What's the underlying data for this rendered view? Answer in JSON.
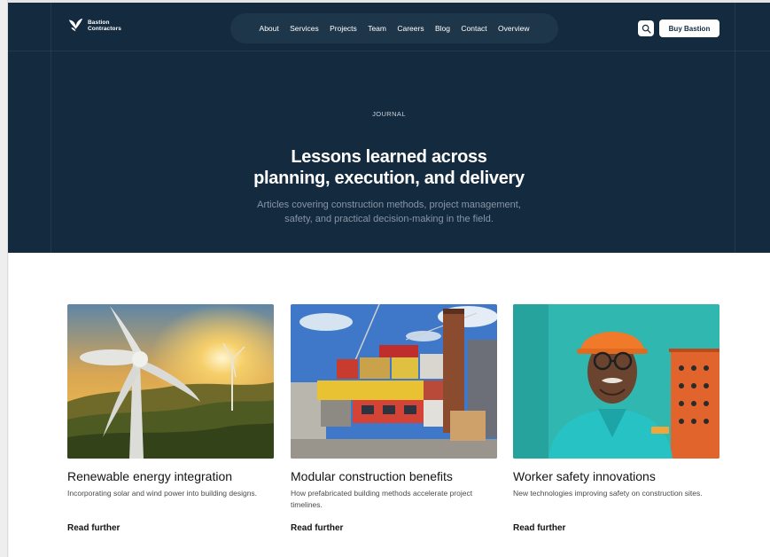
{
  "brand": {
    "line1": "Bastion",
    "line2": "Contractors"
  },
  "nav": {
    "items": [
      "About",
      "Services",
      "Projects",
      "Team",
      "Careers",
      "Blog",
      "Contact",
      "Overview"
    ]
  },
  "header": {
    "buy_label": "Buy Bastion",
    "search_icon": "search-icon"
  },
  "hero": {
    "eyebrow": "JOURNAL",
    "title_line1": "Lessons learned across",
    "title_line2": "planning, execution, and delivery",
    "subtitle_line1": "Articles covering construction methods, project management,",
    "subtitle_line2": "safety, and practical decision-making in the field."
  },
  "articles": [
    {
      "title": "Renewable energy integration",
      "description": "Incorporating solar and wind power into building designs.",
      "link": "Read further",
      "image": "wind-turbine-sunset-image"
    },
    {
      "title": "Modular construction benefits",
      "description": "How prefabricated building methods accelerate project timelines.",
      "link": "Read further",
      "image": "modular-container-building-image"
    },
    {
      "title": "Worker safety innovations",
      "description": "New technologies improving safety on construction sites.",
      "link": "Read further",
      "image": "worker-hard-hat-image"
    }
  ],
  "colors": {
    "hero_bg": "#142a3f",
    "nav_pill": "#1e3649",
    "page_bg": "#ffffff"
  }
}
